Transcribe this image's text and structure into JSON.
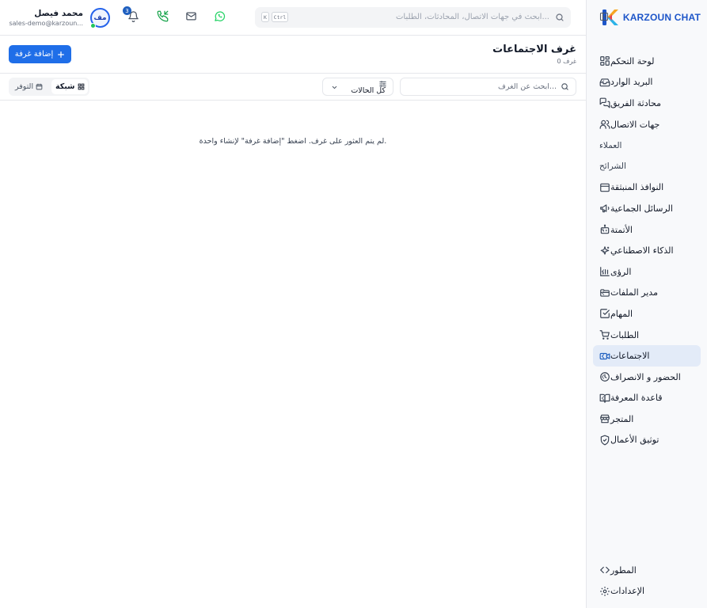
{
  "brand": {
    "name": "KARZOUN CHAT"
  },
  "header": {
    "search_placeholder": "ابحث في جهات الاتصال، المحادثات، الطلبات...",
    "kbd_ctrl": "Ctrl",
    "kbd_k": "K",
    "notification_count": "3",
    "user": {
      "initials": "مف",
      "name": "محمد فيصل",
      "email": "sales-demo@karzoun..."
    }
  },
  "page": {
    "title": "غرف الاجتماعات",
    "count": "0 غرف",
    "add_button": "إضافة غرفة",
    "search_placeholder": "ابحث عن الغرف...",
    "status_filter": "كل الحالات",
    "view_grid": "شبكة",
    "view_availability": "التوفر",
    "empty_message": "لم يتم العثور على غرف. اضغط \"إضافة غرفة\" لإنشاء واحدة."
  },
  "sidebar": {
    "items": [
      {
        "label": "لوحة التحكم",
        "icon": "dashboard-icon"
      },
      {
        "label": "البريد الوارد",
        "icon": "inbox-icon"
      },
      {
        "label": "محادثة الفريق",
        "icon": "team-chat-icon"
      },
      {
        "label": "جهات الاتصال",
        "icon": "contacts-icon"
      },
      {
        "label": "العملاء"
      },
      {
        "label": "الشرائح"
      },
      {
        "label": "النوافذ المنبثقة",
        "icon": "popup-window-icon"
      },
      {
        "label": "الرسائل الجماعية",
        "icon": "megaphone-icon"
      },
      {
        "label": "الأتمتة",
        "icon": "bot-icon"
      },
      {
        "label": "الذكاء الاصطناعي",
        "icon": "sparkles-icon"
      },
      {
        "label": "الرؤى",
        "icon": "bar-chart-icon"
      },
      {
        "label": "مدير الملفات",
        "icon": "folder-icon"
      },
      {
        "label": "المهام",
        "icon": "checkbox-icon"
      },
      {
        "label": "الطلبات",
        "icon": "cart-icon"
      },
      {
        "label": "الاجتماعات",
        "icon": "video-icon"
      },
      {
        "label": "الحضور و الانصراف",
        "icon": "clock-icon"
      },
      {
        "label": "قاعدة المعرفة",
        "icon": "book-icon"
      },
      {
        "label": "المتجر",
        "icon": "store-icon"
      },
      {
        "label": "توثيق الأعمال",
        "icon": "shield-check-icon"
      }
    ],
    "bottom": [
      {
        "label": "المطور",
        "icon": "code-icon"
      },
      {
        "label": "الإعدادات",
        "icon": "gear-icon"
      }
    ]
  },
  "colors": {
    "accent": "#1f6ee8",
    "active_bg": "#e3ebf8",
    "whatsapp": "#25d366",
    "online": "#22c55e"
  }
}
